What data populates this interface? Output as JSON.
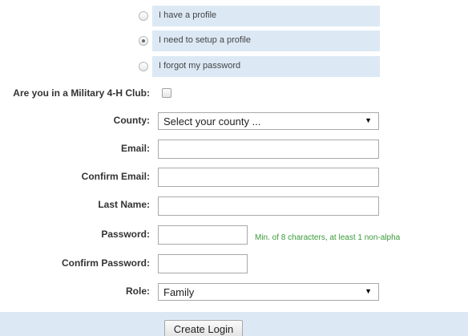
{
  "profile_options": [
    {
      "label": "I have a profile",
      "checked": false
    },
    {
      "label": "I need to setup a profile",
      "checked": true
    },
    {
      "label": "I forgot my password",
      "checked": false
    }
  ],
  "military": {
    "label": "Are you in a Military 4-H Club:",
    "checked": false
  },
  "county": {
    "label": "County:",
    "value": "Select your county ..."
  },
  "email": {
    "label": "Email:",
    "value": ""
  },
  "confirm_email": {
    "label": "Confirm Email:",
    "value": ""
  },
  "last_name": {
    "label": "Last Name:",
    "value": ""
  },
  "password": {
    "label": "Password:",
    "value": "",
    "hint": "Min. of 8 characters, at least 1 non-alpha"
  },
  "confirm_password": {
    "label": "Confirm Password:",
    "value": ""
  },
  "role": {
    "label": "Role:",
    "value": "Family"
  },
  "footer": {
    "create_label": "Create Login"
  },
  "icons": {
    "dropdown": "dropdown-arrow-icon"
  },
  "colors": {
    "option_bg": "#dce9f5",
    "hint": "#3a9a3a",
    "footer_bg": "#dce9f5"
  }
}
